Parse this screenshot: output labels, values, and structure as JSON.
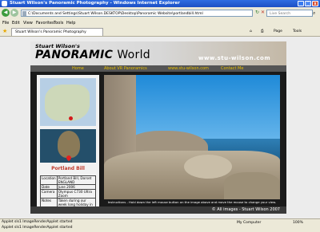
{
  "window": {
    "title": "Stuart Wilson's Panoramic Photography - Windows Internet Explorer",
    "minimize": "_",
    "maximize": "□",
    "close": "x"
  },
  "address_bar": {
    "url": "C:\\Documents and Settings\\Stuart Wilson.DESKTOP\\Desktop\\Panoramic Website\\portlandbill.html",
    "search_placeholder": "Live Search"
  },
  "menu": [
    "File",
    "Edit",
    "View",
    "Favorites",
    "Tools",
    "Help"
  ],
  "favorites_bar": {
    "tab_title": "Stuart Wilson's Panoramic Photography",
    "page_label": "Page",
    "tools_label": "Tools"
  },
  "site": {
    "header_name": "Stuart Wilson's",
    "header_brand": "PANORAMIC",
    "header_world": "World",
    "header_url": "www.stu-wilson.com",
    "nav": [
      "Home",
      "About VR Panoramics",
      "www.stu-wilson.com",
      "Contact Me"
    ],
    "location_title": "Portland Bill",
    "info": [
      {
        "label": "Location",
        "value": "Portland Bill, Dorset ENGLAND"
      },
      {
        "label": "Date",
        "value": "June 2006"
      },
      {
        "label": "Camera",
        "value": "Olympus C730 Ultra Zoom"
      },
      {
        "label": "Notes",
        "value": "Taken during our week long holiday in Weymouth"
      }
    ],
    "instructions": "Instructions - Hold down the left mouse button on the image above and move the mouse to change your view.",
    "footer": "© All images - Stuart Wilson 2007"
  },
  "status_bar": {
    "line1": "Applet sls1 ImageRenderApplet started",
    "line2": "Applet sls1 ImageRenderApplet started",
    "zone": "My Computer",
    "zoom": "100%"
  }
}
